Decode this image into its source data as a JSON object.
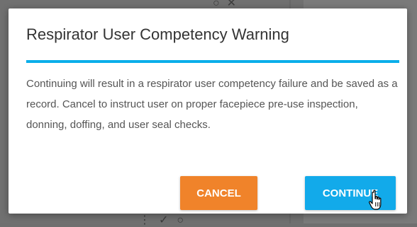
{
  "dialog": {
    "title": "Respirator User Competency Warning",
    "body": "Continuing will result in a respirator user competency failure and be saved as a record. Cancel to instruct user on proper facepiece pre-use inspection, donning, doffing, and user seal checks.",
    "cancel_label": "CANCEL",
    "continue_label": "CONTINUE",
    "accent_color": "#0aaeea",
    "cancel_color": "#f0832a",
    "continue_color": "#12aaea"
  },
  "cursor": {
    "icon": "hand-pointer-icon"
  }
}
